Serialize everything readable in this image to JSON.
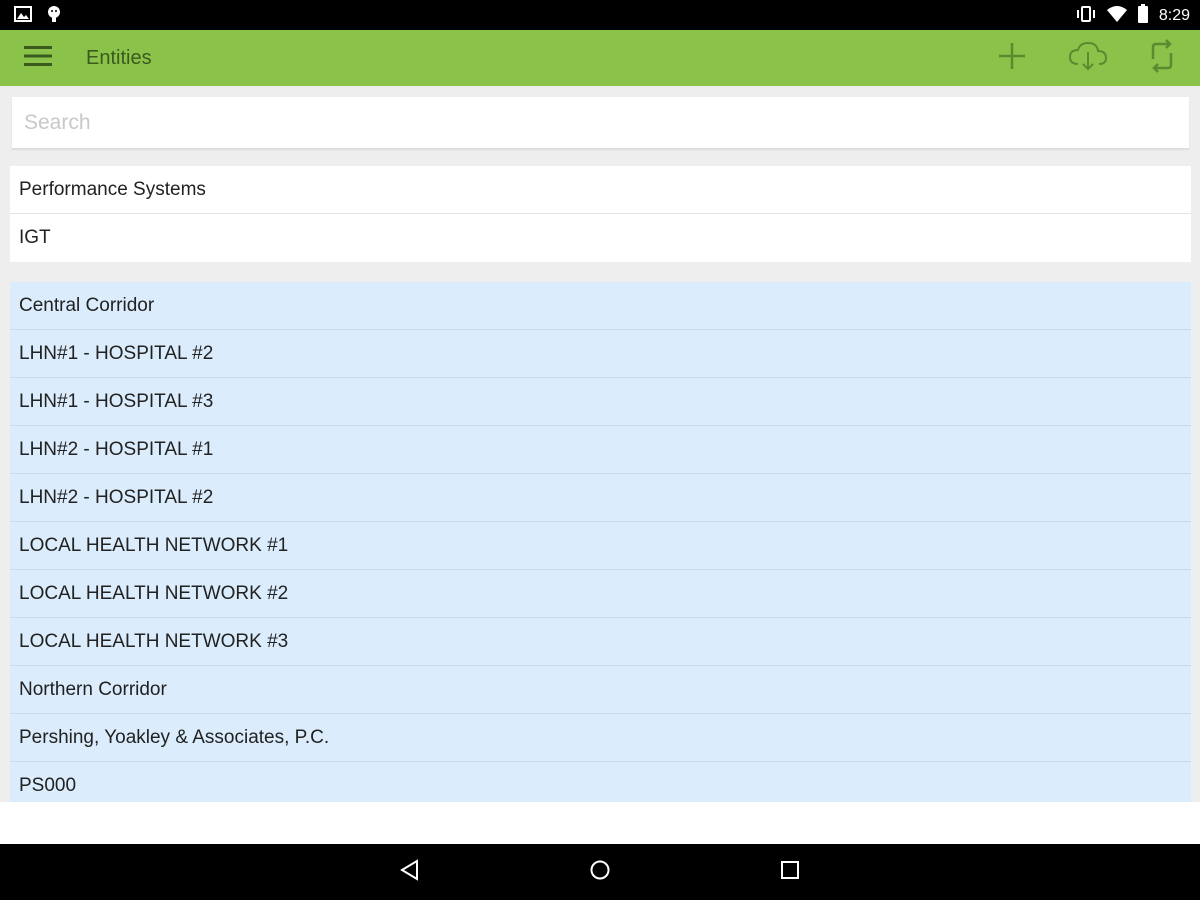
{
  "status_bar": {
    "time": "8:29",
    "left_icons": [
      "image-notification-icon",
      "android-notification-icon"
    ],
    "right_icons": [
      "vibrate-icon",
      "wifi-icon",
      "battery-icon"
    ]
  },
  "app_bar": {
    "title": "Entities",
    "menu_icon": "hamburger-menu-icon",
    "actions": [
      "add-icon",
      "cloud-download-icon",
      "sync-icon"
    ],
    "color": "#8bc34a"
  },
  "search": {
    "placeholder": "Search",
    "value": ""
  },
  "top_list": {
    "items": [
      "Performance Systems",
      "IGT"
    ]
  },
  "main_list": {
    "highlight_color": "#dbecfc",
    "items": [
      "Central Corridor",
      "LHN#1 - HOSPITAL #2",
      "LHN#1 - HOSPITAL #3",
      "LHN#2 - HOSPITAL #1",
      "LHN#2 - HOSPITAL #2",
      "LOCAL HEALTH NETWORK #1",
      "LOCAL HEALTH NETWORK #2",
      "LOCAL HEALTH NETWORK #3",
      "Northern Corridor",
      "Pershing, Yoakley & Associates, P.C.",
      "PS000"
    ]
  },
  "nav_bar": {
    "buttons": [
      "back-icon",
      "home-icon",
      "recents-icon"
    ]
  }
}
